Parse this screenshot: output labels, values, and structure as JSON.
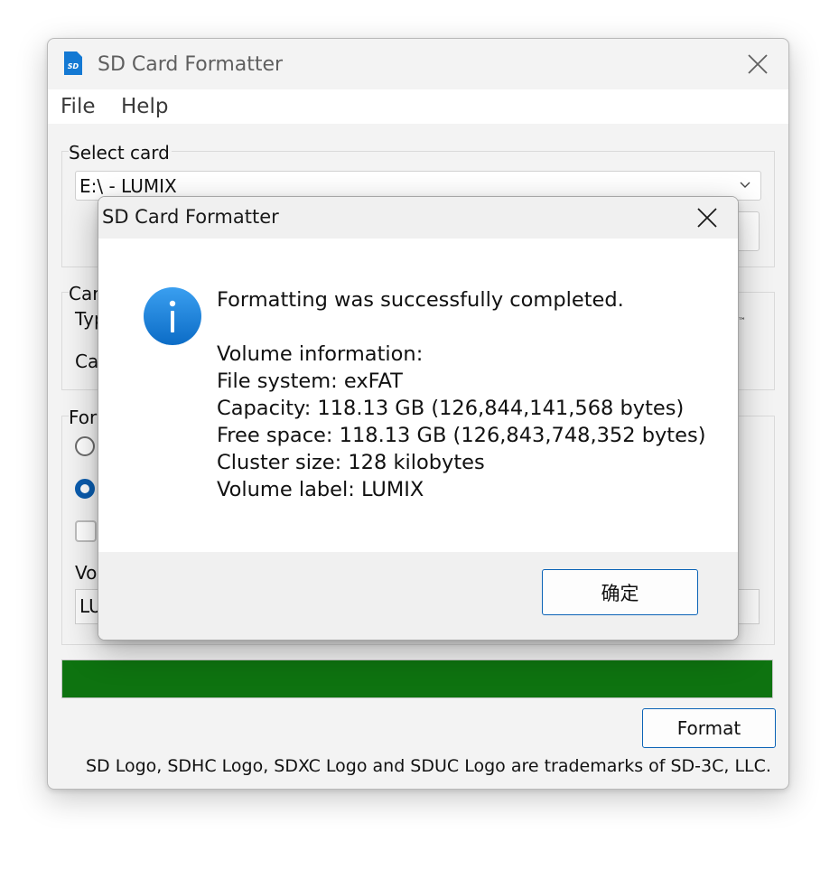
{
  "window": {
    "title": "SD Card Formatter",
    "menu": [
      "File",
      "Help"
    ]
  },
  "main": {
    "select_card": {
      "label": "Select card",
      "selected": "E:\\ - LUMIX",
      "refresh_label": ""
    },
    "card_info": {
      "label_partial": "Car",
      "type_partial": "Typ",
      "capacity_partial": "Cap",
      "trademark_partial": "™"
    },
    "format_options": {
      "label_partial": "Forr",
      "volume_label_partial": "Vol",
      "volume_value_partial": "LU"
    },
    "progress_percent": 100,
    "format_button": "Format",
    "trademark_footer": "SD Logo, SDHC Logo, SDXC Logo and SDUC Logo are trademarks of SD-3C, LLC."
  },
  "dialog": {
    "title": "SD Card Formatter",
    "icon": "info-icon",
    "message": "Formatting was successfully completed.",
    "volume_header": "Volume information:",
    "file_system": "File system: exFAT",
    "capacity": "Capacity: 118.13 GB (126,844,141,568 bytes)",
    "free_space": "Free space: 118.13 GB (126,843,748,352 bytes)",
    "cluster_size": "Cluster size: 128 kilobytes",
    "volume_label": "Volume label: LUMIX",
    "ok_button": "确定"
  },
  "colors": {
    "accent": "#0b5cad",
    "progress": "#0e7310",
    "info_icon": "#1a82d8"
  }
}
